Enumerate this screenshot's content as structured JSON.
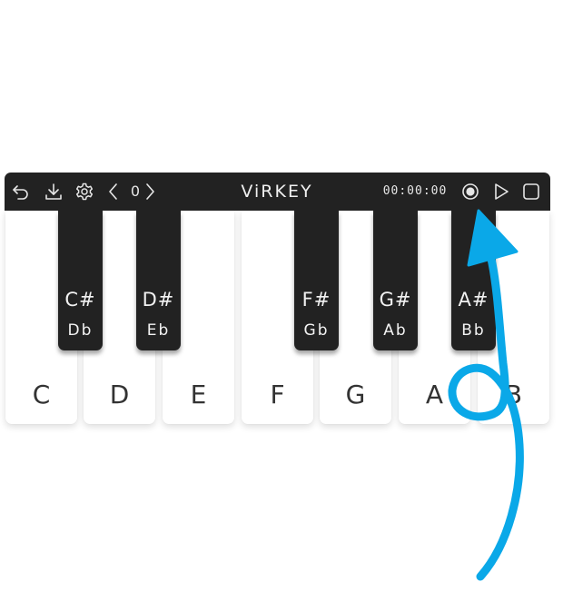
{
  "toolbar": {
    "octave_value": "0",
    "title": "ViRKEY",
    "timer": "00:00:00",
    "icons": [
      "undo-icon",
      "download-icon",
      "gear-icon",
      "chevron-left-icon",
      "chevron-right-icon",
      "record-icon",
      "play-icon",
      "stop-icon"
    ]
  },
  "keyboard": {
    "white_keys": [
      "C",
      "D",
      "E",
      "F",
      "G",
      "A",
      "B"
    ],
    "black_keys": [
      {
        "sharp": "C#",
        "flat": "Db"
      },
      {
        "sharp": "D#",
        "flat": "Eb"
      },
      {
        "sharp": "F#",
        "flat": "Gb"
      },
      {
        "sharp": "G#",
        "flat": "Ab"
      },
      {
        "sharp": "A#",
        "flat": "Bb"
      }
    ]
  },
  "colors": {
    "toolbar_bg": "#222222",
    "black_key": "#222222",
    "white_key": "#ffffff",
    "annotation_arrow": "#0aa8e8"
  }
}
